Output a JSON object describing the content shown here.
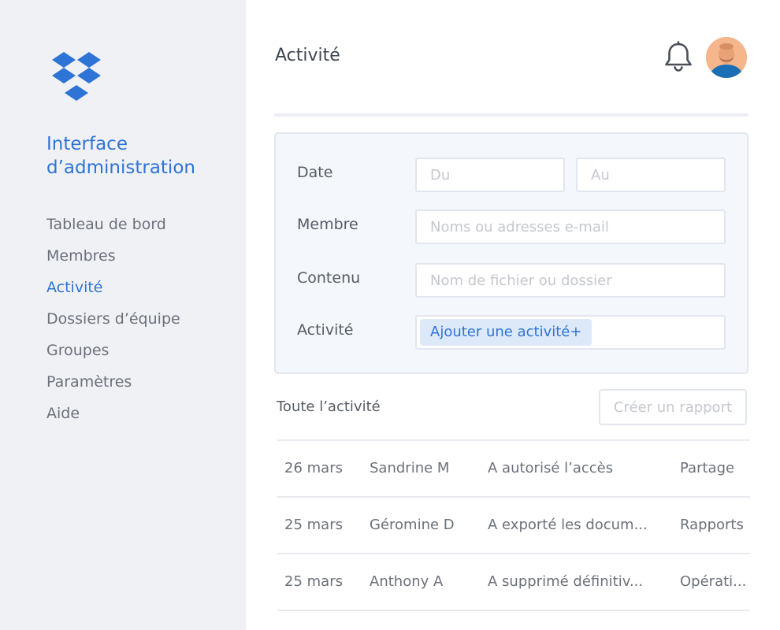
{
  "sidebar": {
    "logo_icon": "dropbox-logo-icon",
    "product_title": "Interface d’administration",
    "nav": [
      {
        "label": "Tableau de bord",
        "active": false
      },
      {
        "label": "Membres",
        "active": false
      },
      {
        "label": "Activité",
        "active": true
      },
      {
        "label": "Dossiers d’équipe",
        "active": false
      },
      {
        "label": "Groupes",
        "active": false
      },
      {
        "label": "Paramètres",
        "active": false
      },
      {
        "label": "Aide",
        "active": false
      }
    ]
  },
  "header": {
    "title": "Activité",
    "notification_icon": "bell-icon",
    "avatar_icon": "user-avatar"
  },
  "filters": {
    "date_label": "Date",
    "date_from_placeholder": "Du",
    "date_to_placeholder": "Au",
    "member_label": "Membre",
    "member_placeholder": "Noms ou adresses e-mail",
    "content_label": "Contenu",
    "content_placeholder": "Nom de fichier ou dossier",
    "activity_label": "Activité",
    "activity_chip": "Ajouter une activité+"
  },
  "activity": {
    "title": "Toute l’activité",
    "report_button": "Créer un rapport",
    "rows": [
      {
        "date": "26 mars",
        "member": "Sandrine M",
        "action": "A autorisé l’accès",
        "type": "Partage"
      },
      {
        "date": "25 mars",
        "member": "Géromine D",
        "action": "A exporté les docum...",
        "type": "Rapports"
      },
      {
        "date": "25 mars",
        "member": "Anthony A",
        "action": "A supprimé définitiv...",
        "type": "Opérati..."
      }
    ]
  },
  "colors": {
    "accent": "#2e74d6",
    "sidebar_bg": "#f0f1f5",
    "panel_bg": "#f4f7fb",
    "chip_bg": "#dde9f8",
    "border": "#e2e6ee"
  }
}
